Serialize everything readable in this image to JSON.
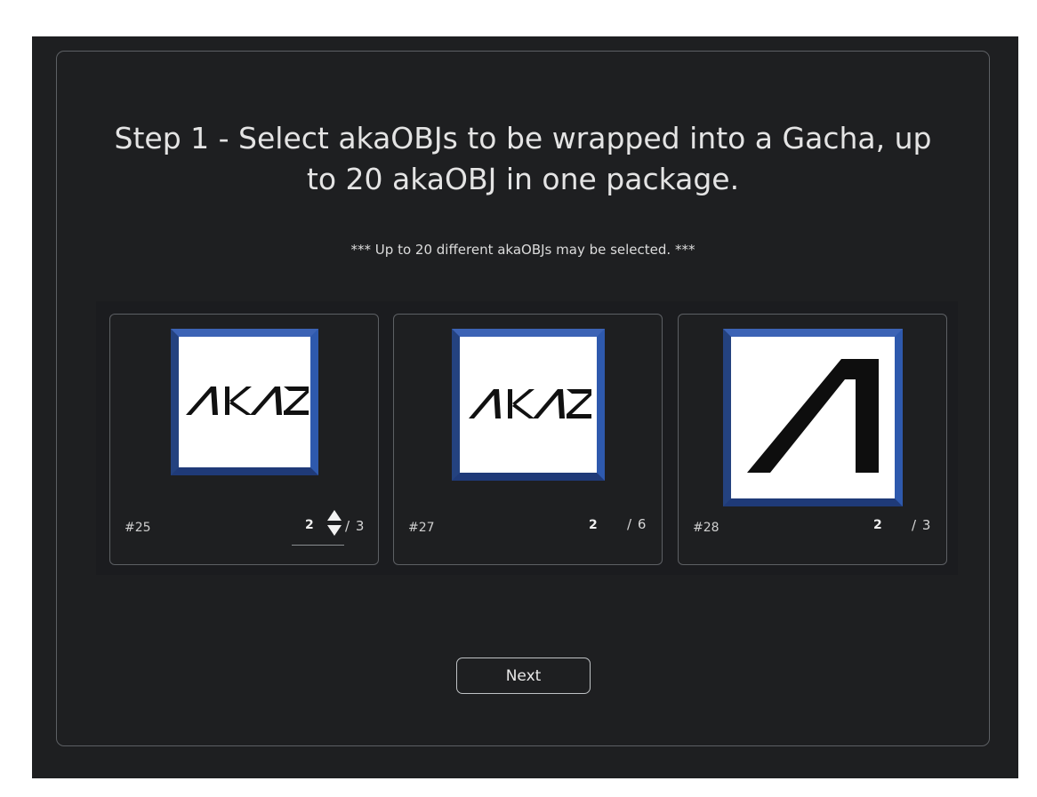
{
  "step_title": "Step 1 - Select akaOBJs to be wrapped into a Gacha, up to 20 akaOBJ in one package.",
  "note": "*** Up to 20 different akaOBJs may be selected. ***",
  "cards": [
    {
      "id": "#25",
      "quantity": "2",
      "max": "/ 3",
      "logo": "akas-wordmark-icon"
    },
    {
      "id": "#27",
      "quantity": "2",
      "max": "/ 6",
      "logo": "akas-wordmark-icon"
    },
    {
      "id": "#28",
      "quantity": "2",
      "max": "/ 3",
      "logo": "akas-a-mark-icon"
    }
  ],
  "next_label": "Next",
  "colors": {
    "background": "#1e1f21",
    "frame_border": "#2b4f9a",
    "text": "#e8e8e8"
  }
}
